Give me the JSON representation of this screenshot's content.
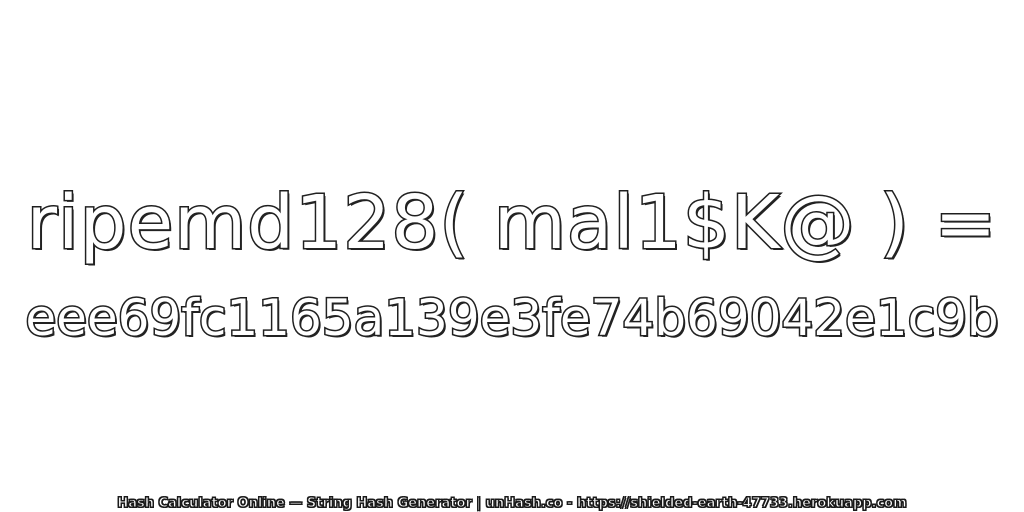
{
  "expression": "ripemd128( mal1$K@ ) =",
  "hash_value": "eee69fc1165a139e3fe74b69042e1c9b",
  "footer": "Hash Calculator Online — String Hash Generator | unHash.co - https://shielded-earth-47733.herokuapp.com",
  "colors": {
    "background": "#ffffff",
    "text_fill": "#ffffff",
    "text_outline": "#1a1a1a"
  }
}
